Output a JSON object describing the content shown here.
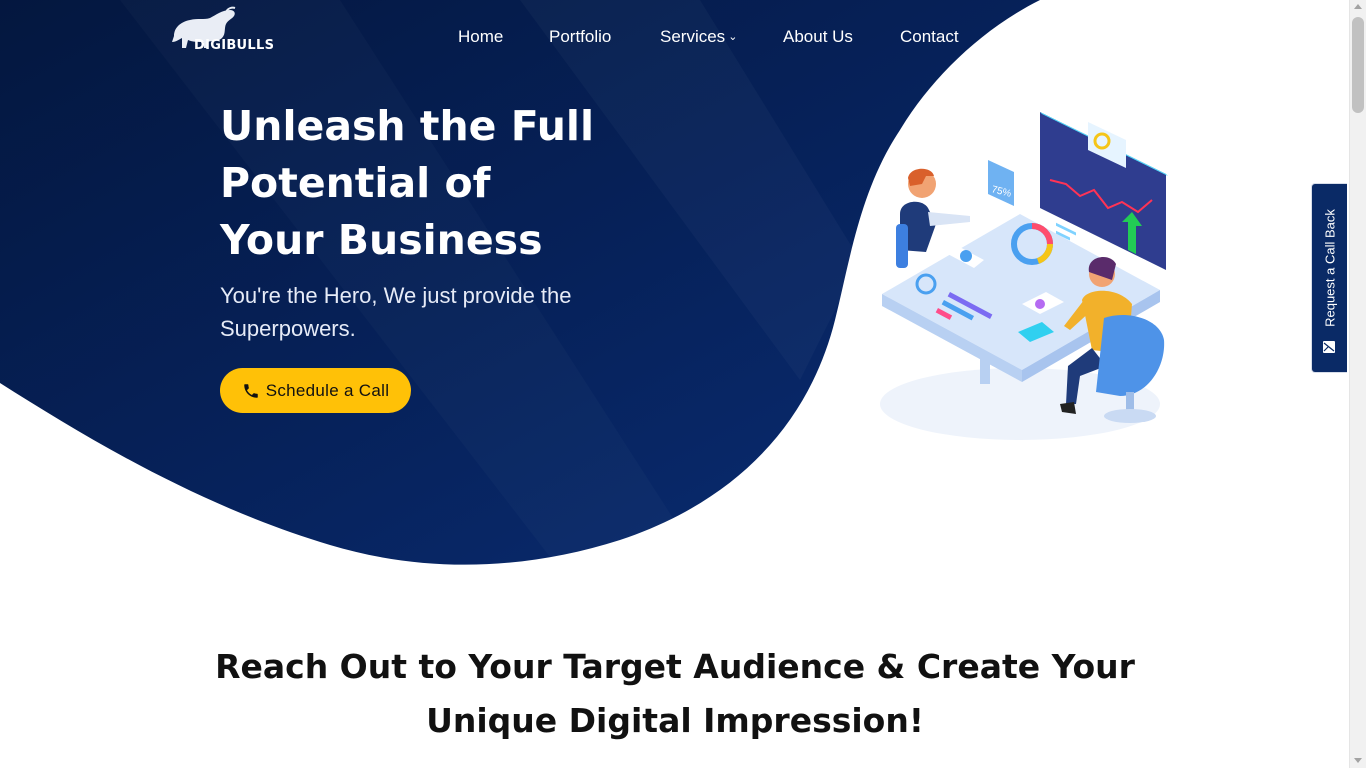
{
  "brand": {
    "name": "DIGIBULLS"
  },
  "nav": {
    "items": [
      {
        "label": "Home"
      },
      {
        "label": "Portfolio"
      },
      {
        "label": "Services"
      },
      {
        "label": "About Us"
      },
      {
        "label": "Contact"
      }
    ]
  },
  "hero": {
    "title_lines": [
      "Unleash the Full",
      "Potential of",
      "Your Business"
    ],
    "subtitle": "You're the Hero, We just provide the Superpowers.",
    "cta_label": "Schedule a Call"
  },
  "illustration": {
    "badge_text": "75%"
  },
  "side_tab": {
    "label": "Request a Call Back"
  },
  "section": {
    "title": "Reach Out to Your Target Audience & Create Your Unique Digital Impression!"
  },
  "colors": {
    "navy": "#0a2a66",
    "accent": "#ffc107",
    "white": "#ffffff"
  }
}
